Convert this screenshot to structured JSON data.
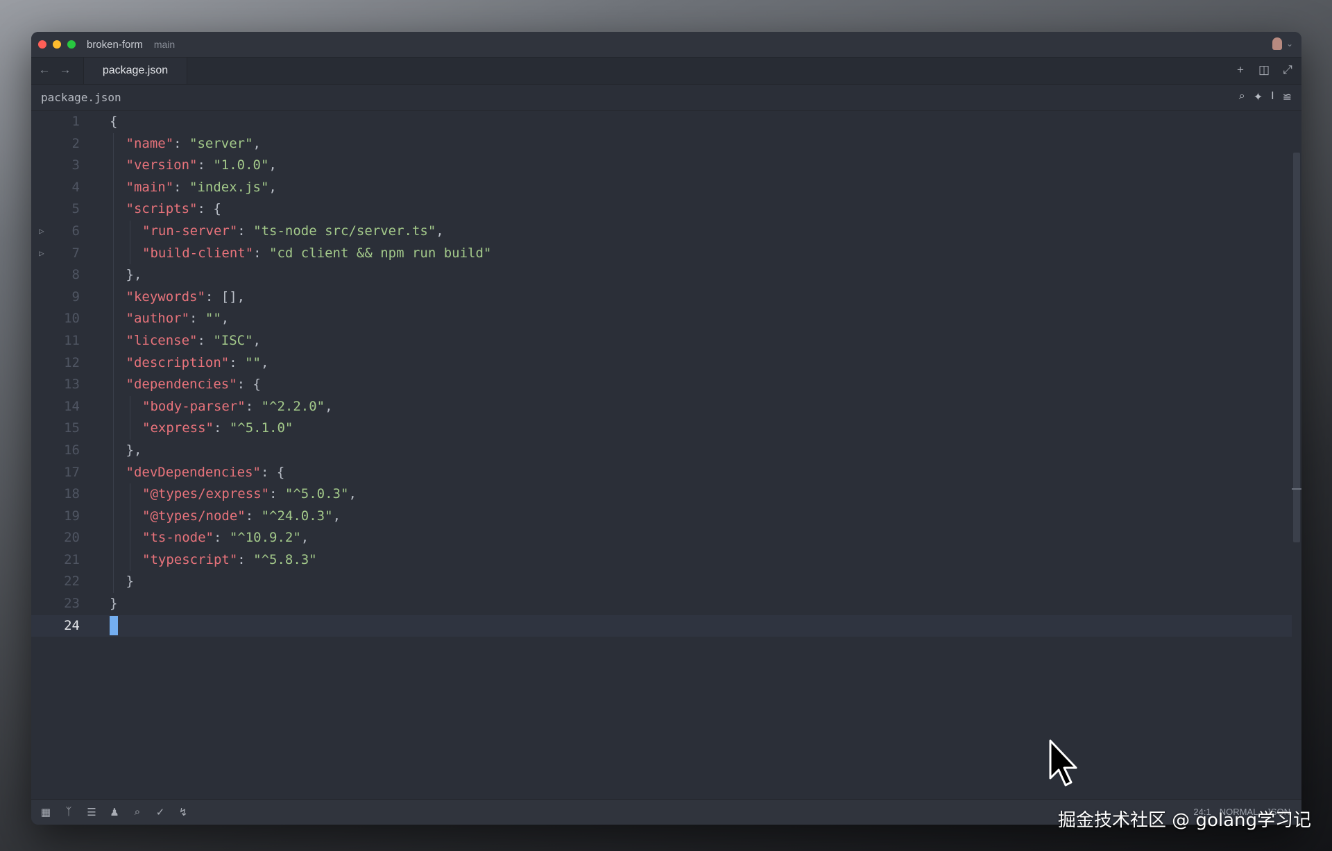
{
  "window": {
    "project": "broken-form",
    "branch": "main"
  },
  "tabs": [
    {
      "label": "package.json",
      "active": true
    }
  ],
  "breadcrumb": "package.json",
  "icons": {
    "titlebar": [
      "avatar-icon",
      "chevron-down-icon"
    ],
    "nav": [
      "back-arrow-icon",
      "forward-arrow-icon"
    ],
    "tab_tools": [
      "plus-icon",
      "split-pane-icon",
      "expand-icon"
    ],
    "breadcrumb_tools": [
      "search-icon",
      "sparkle-icon",
      "text-cursor-icon",
      "settings-sliders-icon"
    ],
    "status_left": [
      "panel-icon",
      "git-branch-icon",
      "outline-icon",
      "collab-icon",
      "search-icon",
      "check-icon",
      "bolt-icon"
    ]
  },
  "editor": {
    "current_line": 24,
    "lines": [
      {
        "n": "1",
        "indent": 0,
        "tokens": [
          [
            "p",
            "{"
          ]
        ]
      },
      {
        "n": "2",
        "indent": 1,
        "tokens": [
          [
            "k",
            "\"name\""
          ],
          [
            "p",
            ": "
          ],
          [
            "s",
            "\"server\""
          ],
          [
            "p",
            ","
          ]
        ]
      },
      {
        "n": "3",
        "indent": 1,
        "tokens": [
          [
            "k",
            "\"version\""
          ],
          [
            "p",
            ": "
          ],
          [
            "s",
            "\"1.0.0\""
          ],
          [
            "p",
            ","
          ]
        ]
      },
      {
        "n": "4",
        "indent": 1,
        "tokens": [
          [
            "k",
            "\"main\""
          ],
          [
            "p",
            ": "
          ],
          [
            "s",
            "\"index.js\""
          ],
          [
            "p",
            ","
          ]
        ]
      },
      {
        "n": "5",
        "indent": 1,
        "tokens": [
          [
            "k",
            "\"scripts\""
          ],
          [
            "p",
            ": {"
          ]
        ]
      },
      {
        "n": "6",
        "indent": 2,
        "fold": true,
        "tokens": [
          [
            "k",
            "\"run-server\""
          ],
          [
            "p",
            ": "
          ],
          [
            "s",
            "\"ts-node src/server.ts\""
          ],
          [
            "p",
            ","
          ]
        ]
      },
      {
        "n": "7",
        "indent": 2,
        "fold": true,
        "tokens": [
          [
            "k",
            "\"build-client\""
          ],
          [
            "p",
            ": "
          ],
          [
            "s",
            "\"cd client && npm run build\""
          ]
        ]
      },
      {
        "n": "8",
        "indent": 1,
        "tokens": [
          [
            "p",
            "},"
          ]
        ]
      },
      {
        "n": "9",
        "indent": 1,
        "tokens": [
          [
            "k",
            "\"keywords\""
          ],
          [
            "p",
            ": [],"
          ]
        ]
      },
      {
        "n": "10",
        "indent": 1,
        "tokens": [
          [
            "k",
            "\"author\""
          ],
          [
            "p",
            ": "
          ],
          [
            "s",
            "\"\""
          ],
          [
            "p",
            ","
          ]
        ]
      },
      {
        "n": "11",
        "indent": 1,
        "tokens": [
          [
            "k",
            "\"license\""
          ],
          [
            "p",
            ": "
          ],
          [
            "s",
            "\"ISC\""
          ],
          [
            "p",
            ","
          ]
        ]
      },
      {
        "n": "12",
        "indent": 1,
        "tokens": [
          [
            "k",
            "\"description\""
          ],
          [
            "p",
            ": "
          ],
          [
            "s",
            "\"\""
          ],
          [
            "p",
            ","
          ]
        ]
      },
      {
        "n": "13",
        "indent": 1,
        "tokens": [
          [
            "k",
            "\"dependencies\""
          ],
          [
            "p",
            ": {"
          ]
        ]
      },
      {
        "n": "14",
        "indent": 2,
        "tokens": [
          [
            "k",
            "\"body-parser\""
          ],
          [
            "p",
            ": "
          ],
          [
            "s",
            "\"^2.2.0\""
          ],
          [
            "p",
            ","
          ]
        ]
      },
      {
        "n": "15",
        "indent": 2,
        "tokens": [
          [
            "k",
            "\"express\""
          ],
          [
            "p",
            ": "
          ],
          [
            "s",
            "\"^5.1.0\""
          ]
        ]
      },
      {
        "n": "16",
        "indent": 1,
        "tokens": [
          [
            "p",
            "},"
          ]
        ]
      },
      {
        "n": "17",
        "indent": 1,
        "tokens": [
          [
            "k",
            "\"devDependencies\""
          ],
          [
            "p",
            ": {"
          ]
        ]
      },
      {
        "n": "18",
        "indent": 2,
        "tokens": [
          [
            "k",
            "\"@types/express\""
          ],
          [
            "p",
            ": "
          ],
          [
            "s",
            "\"^5.0.3\""
          ],
          [
            "p",
            ","
          ]
        ]
      },
      {
        "n": "19",
        "indent": 2,
        "tokens": [
          [
            "k",
            "\"@types/node\""
          ],
          [
            "p",
            ": "
          ],
          [
            "s",
            "\"^24.0.3\""
          ],
          [
            "p",
            ","
          ]
        ]
      },
      {
        "n": "20",
        "indent": 2,
        "tokens": [
          [
            "k",
            "\"ts-node\""
          ],
          [
            "p",
            ": "
          ],
          [
            "s",
            "\"^10.9.2\""
          ],
          [
            "p",
            ","
          ]
        ]
      },
      {
        "n": "21",
        "indent": 2,
        "tokens": [
          [
            "k",
            "\"typescript\""
          ],
          [
            "p",
            ": "
          ],
          [
            "s",
            "\"^5.8.3\""
          ]
        ]
      },
      {
        "n": "22",
        "indent": 1,
        "tokens": [
          [
            "p",
            "}"
          ]
        ]
      },
      {
        "n": "23",
        "indent": 0,
        "tokens": [
          [
            "p",
            "}"
          ]
        ]
      },
      {
        "n": "24",
        "indent": 0,
        "cursor": true,
        "tokens": []
      }
    ]
  },
  "statusbar": {
    "position": "24:1",
    "mode": "NORMAL",
    "language": "JSON"
  },
  "watermark": "掘金技术社区 @ golang学习记",
  "colors": {
    "key": "#e8737b",
    "string": "#a3c98a",
    "editor_bg": "#2b2f38",
    "cursor": "#74aef0"
  }
}
